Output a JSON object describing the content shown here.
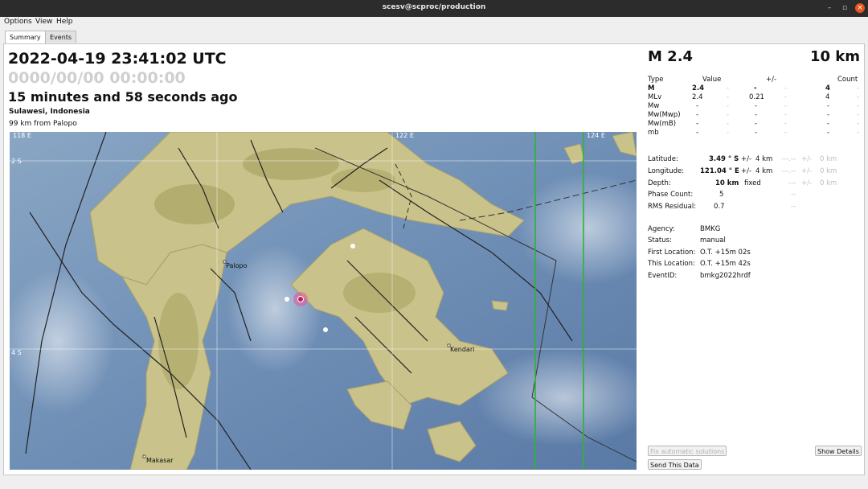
{
  "window": {
    "title": "scesv@scproc/production",
    "min": "–",
    "max": "▫",
    "close": "×"
  },
  "menu": [
    {
      "label": "Options"
    },
    {
      "label": "View"
    },
    {
      "label": "Help"
    }
  ],
  "tabs": [
    {
      "label": "Summary"
    },
    {
      "label": "Events"
    }
  ],
  "event": {
    "origin_time": "2022-04-19 23:41:02 UTC",
    "local_time": "0000/00/00  00:00:00",
    "ago": "15 minutes and 58 seconds ago",
    "region": "Sulawesi, Indonesia",
    "nearest": "99 km from Palopo"
  },
  "map": {
    "lon_labels": [
      "118 E",
      "122 E",
      "124 E"
    ],
    "lat_labels": [
      "2 S",
      "4 S"
    ],
    "cities": [
      "Palopo",
      "Kendari",
      "Makasar"
    ]
  },
  "summary": {
    "magnitude": "M 2.4",
    "depth": "10 km"
  },
  "mag_table": {
    "headers": [
      "Type",
      "Value",
      "+/-",
      "Count"
    ],
    "rows": [
      {
        "type": "M",
        "value": "2.4",
        "err": "-",
        "count": "4",
        "bold": true
      },
      {
        "type": "MLv",
        "value": "2.4",
        "err": "0.21",
        "count": "4",
        "bold": false
      },
      {
        "type": "Mw",
        "value": "-",
        "err": "-",
        "count": "-",
        "bold": false
      },
      {
        "type": "Mw(Mwp)",
        "value": "-",
        "err": "-",
        "count": "-",
        "bold": false
      },
      {
        "type": "Mw(mB)",
        "value": "-",
        "err": "-",
        "count": "-",
        "bold": false
      },
      {
        "type": "mb",
        "value": "-",
        "err": "-",
        "count": "-",
        "bold": false
      }
    ],
    "sep": "-"
  },
  "location": {
    "latitude_label": "Latitude:",
    "latitude": "3.49 ° S",
    "lat_pm": "+/-",
    "lat_err": "4 km",
    "lat_alt": "---.--",
    "lat_alt_pm": "+/-",
    "lat_alt_err": "0 km",
    "longitude_label": "Longitude:",
    "longitude": "121.04 ° E",
    "lon_pm": "+/-",
    "lon_err": "4 km",
    "lon_alt": "---.--",
    "lon_alt_pm": "+/-",
    "lon_alt_err": "0 km",
    "depth_label": "Depth:",
    "depth": "10 km",
    "depth_type": "fixed",
    "depth_alt": "---",
    "depth_alt_pm": "+/-",
    "depth_alt_err": "0 km",
    "phase_label": "Phase Count:",
    "phase": "5",
    "phase_alt": "--",
    "rms_label": "RMS Residual:",
    "rms": "0.7",
    "rms_alt": "--"
  },
  "info": {
    "agency_label": "Agency:",
    "agency": "BMKG",
    "status_label": "Status:",
    "status": "manual",
    "first_label": "First Location:",
    "first": "O.T. +15m 02s",
    "this_label": "This Location:",
    "this": "O.T. +15m 42s",
    "eventid_label": "EventID:",
    "eventid": "bmkg2022hrdf"
  },
  "buttons": {
    "fix": "Fix automatic solutions",
    "details": "Show Details",
    "send": "Send This Data"
  }
}
